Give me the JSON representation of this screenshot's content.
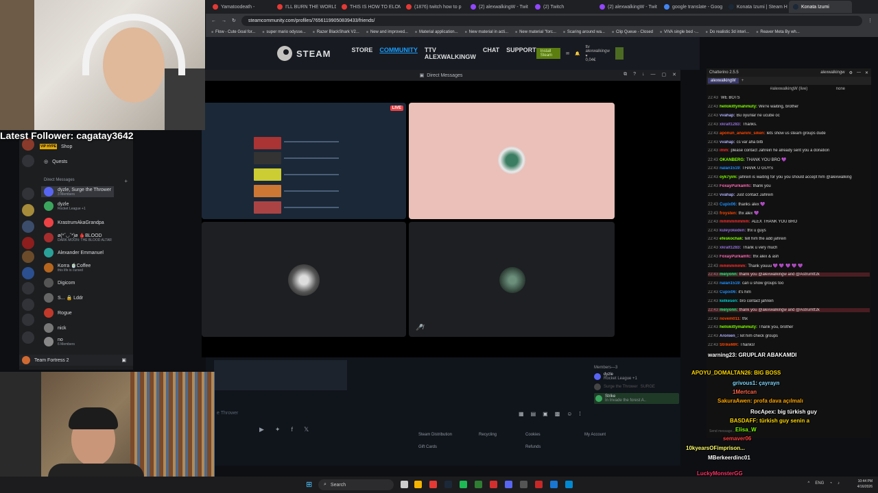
{
  "browser": {
    "tabs": [
      {
        "label": "Yamatoodeath - ",
        "color": "#e53935"
      },
      {
        "label": "I'LL BURN THE WORLD",
        "color": "#e53935"
      },
      {
        "label": "THIS IS HOW TO ELOM",
        "color": "#e53935"
      },
      {
        "label": "(1876) twitch how to p",
        "color": "#e53935"
      },
      {
        "label": "(2) alexwalkingW - Twit",
        "color": "#9146ff"
      },
      {
        "label": "(2) Twitch",
        "color": "#9146ff"
      },
      {
        "label": "(2) alexwalkingW - Twit",
        "color": "#9146ff"
      },
      {
        "label": "google translate - Goog",
        "color": "#4285f4"
      },
      {
        "label": "Konata Izumi | Steam Ht",
        "color": "#1b2838"
      },
      {
        "label": "Konata Izumi",
        "color": "#1b2838",
        "active": true
      }
    ],
    "url": "steamcommunity.com/profiles/76561199050839433/friends/",
    "bookmarks": [
      "Flow - Cute Goal for...",
      "super mario odysse...",
      "Razer BlackShark V2...",
      "New and improved...",
      "Material application...",
      "New material in acti...",
      "New material \"forc...",
      "Scaring around wa...",
      "Clip Queue - Closed",
      "VIVA single bed -...",
      "Do realistic 3d interi...",
      "Reaver Meta By wh..."
    ]
  },
  "steam": {
    "logo": "STEAM",
    "nav": [
      "STORE",
      "COMMUNITY",
      "TTV ALEXWALKINGW",
      "CHAT",
      "SUPPORT"
    ],
    "install": "Install Steam",
    "username": "ttv alexwalkingw ▾",
    "wallet": "0,04€",
    "footer": {
      "distribution": "Steam Distribution",
      "recycling": "Recycling",
      "cookies": "Cookies",
      "account": "My Account",
      "giftcards": "Gift Cards",
      "refunds": "Refunds"
    },
    "thrower": "e Thrower"
  },
  "dm_window": {
    "title": "Direct Messages",
    "live_badge": "LIVE"
  },
  "members": {
    "header": "Members—3",
    "items": [
      {
        "name": "dyzle",
        "sub": "Rocket League +1"
      },
      {
        "name": "Surge the Thrower",
        "sub": "SURGE"
      },
      {
        "name": "Strike",
        "sub": "In Invade the forest A.."
      }
    ]
  },
  "discord": {
    "shop": "Shop",
    "quests": "Quests",
    "dm_header": "Direct Messages",
    "dms": [
      {
        "name": "dyzle, Surge the Thrower",
        "sub": "3 Members",
        "color": "#5865f2"
      },
      {
        "name": "dyzle",
        "sub": "Rocket League +1",
        "color": "#3ba55d"
      },
      {
        "name": "KrastrumAkaGrandpa",
        "sub": "",
        "color": "#ed4245"
      },
      {
        "name": "ø(*ˇ◡ˇ*)ø 🩸BLOOD",
        "sub": "DARK MOON: THE BLOOD ALTAR",
        "color": "#a62d2d"
      },
      {
        "name": "Alexander Emmanuel",
        "sub": "",
        "color": "#2aa198"
      },
      {
        "name": "Korra 🍵Coffee",
        "sub": "this life is cursed",
        "color": "#b5651d"
      },
      {
        "name": "Digicom",
        "sub": "",
        "color": "#555"
      },
      {
        "name": "S... 🔒 Lddr",
        "sub": "",
        "color": "#666"
      },
      {
        "name": "Rogue",
        "sub": "",
        "color": "#c0392b"
      },
      {
        "name": "nick",
        "sub": "",
        "color": "#777"
      },
      {
        "name": "no",
        "sub": "6 Members",
        "color": "#888"
      }
    ],
    "vip_badge": "VIP HYPE",
    "footer_server": "Team Fortress 2"
  },
  "stream": {
    "latest_follower": "Latest Follower: cagatay3642"
  },
  "chatterino": {
    "title": "Chatterino 2.5.5",
    "account": "alexwalkingw",
    "tab": "alexwalkingW",
    "channel": "#alexwalkingW (live)",
    "mode": "none",
    "messages": [
      {
        "ts": "22:43",
        "name": "",
        "text": "WE BOTS",
        "color": "#9acd32"
      },
      {
        "ts": "22:43",
        "name": "hellokittymahmuty:",
        "text": "We're waiting, brother",
        "color": "#7fff00"
      },
      {
        "ts": "22:43",
        "name": "vvahap:",
        "text": "Bu oyunlar ne ucube oc",
        "color": "#b0b0ff"
      },
      {
        "ts": "22:43",
        "name": "xkralt1283:",
        "text": "Thanks.",
        "color": "#9370db"
      },
      {
        "ts": "22:43",
        "name": "aponun_ananini_siken:",
        "text": "lets show us steam groups dude",
        "color": "#ff4500"
      },
      {
        "ts": "22:43",
        "name": "vvahap:",
        "text": "cs var aha bitti",
        "color": "#b0b0ff"
      },
      {
        "ts": "22:43",
        "name": "imm:",
        "text": "please contact Jahrein he already sent you a donation",
        "color": "#ff3030"
      },
      {
        "ts": "22:43",
        "name": "OKANBERG:",
        "text": "THANK YOU BRO 💜",
        "color": "#7fff00"
      },
      {
        "ts": "22:43",
        "name": "nalan1519:",
        "text": "THANK U GUYS",
        "color": "#1e90ff"
      },
      {
        "ts": "22:43",
        "name": "oyk7yim:",
        "text": "jahrein is waiting for you you should accept him @alexwalking",
        "color": "#7fff00"
      },
      {
        "ts": "22:43",
        "name": "FoxayPurkamfc:",
        "text": "thank you",
        "color": "#ff69b4"
      },
      {
        "ts": "22:43",
        "name": "vvahap:",
        "text": "Just contact Jahrein",
        "color": "#b0b0ff"
      },
      {
        "ts": "22:43",
        "name": "Cupix06:",
        "text": "thanks alex 💜",
        "color": "#1e90ff"
      },
      {
        "ts": "22:43",
        "name": "froysten:",
        "text": "thx alex 💜",
        "color": "#ff4500"
      },
      {
        "ts": "22:43",
        "name": "mmmmmmmm:",
        "text": "ALEX THANK YOU BRO",
        "color": "#ff3030"
      },
      {
        "ts": "22:43",
        "name": "kuleyokeden:",
        "text": "thx u guys",
        "color": "#9370db"
      },
      {
        "ts": "22:43",
        "name": "efeskochak:",
        "text": "tell him the add jahrein",
        "color": "#7fff00"
      },
      {
        "ts": "22:43",
        "name": "xkralt1283:",
        "text": "Thank u very much",
        "color": "#9370db"
      },
      {
        "ts": "22:43",
        "name": "FoxayPurkamfc:",
        "text": "thx alex & ash",
        "color": "#ff69b4"
      },
      {
        "ts": "22:43",
        "name": "mmmmmmm:",
        "text": "Thank youuu 💜 💜 💜 💜 💜",
        "color": "#ff3030"
      },
      {
        "ts": "22:43",
        "name": "meiyonn:",
        "text": "thank you @alexwalkingw and @Astrumtf2k",
        "color": "#00ff7f",
        "highlight": true
      },
      {
        "ts": "22:43",
        "name": "nalan1519:",
        "text": "can u show groups too",
        "color": "#1e90ff"
      },
      {
        "ts": "22:43",
        "name": "Cupix06:",
        "text": "it's him",
        "color": "#1e90ff"
      },
      {
        "ts": "22:43",
        "name": "kelkesen:",
        "text": "bro contact jahrein",
        "color": "#00ced1"
      },
      {
        "ts": "22:43",
        "name": "meiyonn:",
        "text": "thank you @alexwalkingw and @Astrumtf2k",
        "color": "#00ff7f",
        "highlight": true
      },
      {
        "ts": "22:43",
        "name": "novem011:",
        "text": "thx",
        "color": "#ff4500"
      },
      {
        "ts": "22:43",
        "name": "hellokittymahmuty:",
        "text": "Thank you, brother",
        "color": "#7fff00"
      },
      {
        "ts": "22:43",
        "name": "Aronien_:",
        "text": "let him check groups",
        "color": "#b0b0ff"
      },
      {
        "ts": "22:43",
        "name": "StrikeMR:",
        "text": "Thanks!",
        "color": "#ff4500"
      }
    ],
    "input_placeholder": "Send message..."
  },
  "overlay_names": [
    {
      "text": "warning23: GRUPLAR ABAKAMDI",
      "color": "#ffffff"
    },
    {
      "text": "APOYU_DOMALTAN26: BIG BOSS",
      "color": "#ffd700"
    },
    {
      "text": "grivous1: çayrayn",
      "color": "#7fd7ff"
    },
    {
      "text": "1Mertcan",
      "color": "#ff6347"
    },
    {
      "text": "SakuraAwen: profa dava açılmalı",
      "color": "#ffa500"
    },
    {
      "text": "RocApex: big türkish guy",
      "color": "#ffffff"
    },
    {
      "text": "BASDAFF: türkish guy senin a",
      "color": "#ffd700"
    },
    {
      "text": "Elisa_W",
      "color": "#7cfc00"
    },
    {
      "text": "semaver06",
      "color": "#ff4040"
    },
    {
      "text": "10kyearsOFimprison...",
      "color": "#ffff66"
    },
    {
      "text": "MBerkeerdinc01",
      "color": "#ffffff"
    },
    {
      "text": "LuckyMonsterGG",
      "color": "#ff3366"
    }
  ],
  "taskbar": {
    "search": "Search",
    "lang": "ENG",
    "time": "10:44 PM",
    "date": "4/16/2026"
  }
}
